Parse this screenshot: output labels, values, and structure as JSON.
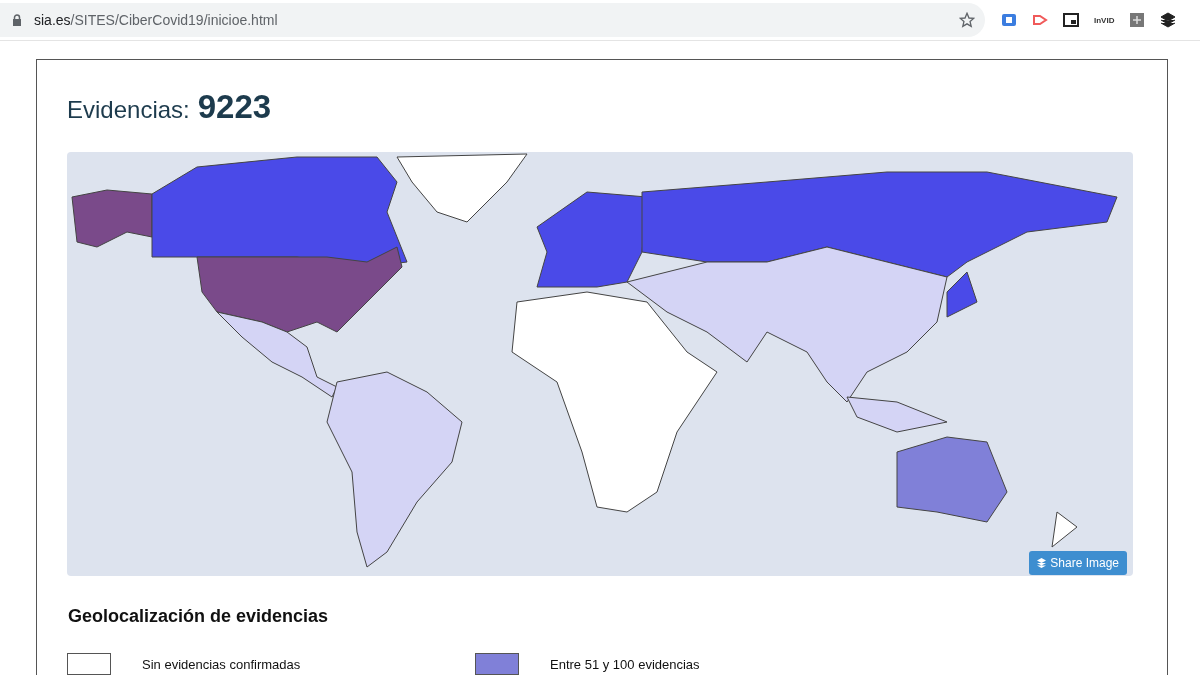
{
  "browser": {
    "url_host": "sia.es",
    "url_path": "/SITES/CiberCovid19/inicioe.html",
    "extension_label": "InVID"
  },
  "page": {
    "title_label": "Evidencias:",
    "title_count": "9223"
  },
  "map": {
    "share_button": "Share Image"
  },
  "legend": {
    "heading": "Geolocalización de evidencias",
    "items": [
      {
        "label": "Sin evidencias confirmadas",
        "color": "#ffffff"
      },
      {
        "label": "Entre 51 y 100 evidencias",
        "color": "#8080d8"
      }
    ]
  }
}
